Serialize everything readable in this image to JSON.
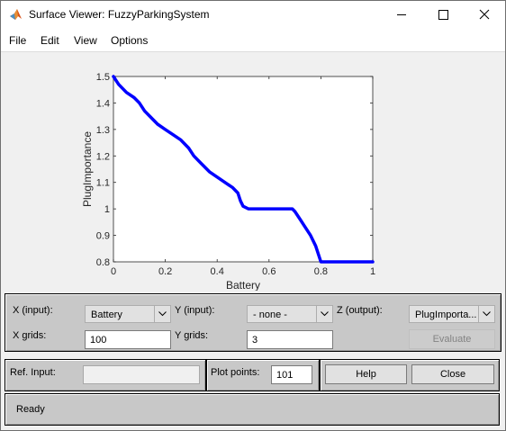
{
  "window": {
    "title": "Surface Viewer: FuzzyParkingSystem"
  },
  "menu": {
    "items": [
      "File",
      "Edit",
      "View",
      "Options"
    ]
  },
  "chart_data": {
    "type": "line",
    "xlabel": "Battery",
    "ylabel": "PlugImportance",
    "xlim": [
      0,
      1
    ],
    "ylim": [
      0.8,
      1.5
    ],
    "xticks": [
      "0",
      "0.2",
      "0.4",
      "0.6",
      "0.8",
      "1"
    ],
    "yticks": [
      "0.8",
      "0.9",
      "1",
      "1.1",
      "1.2",
      "1.3",
      "1.4",
      "1.5"
    ],
    "grid": false,
    "series": [
      {
        "color": "#0000ff",
        "x": [
          0,
          0.02,
          0.05,
          0.08,
          0.1,
          0.12,
          0.14,
          0.17,
          0.2,
          0.23,
          0.26,
          0.29,
          0.31,
          0.34,
          0.37,
          0.4,
          0.43,
          0.46,
          0.48,
          0.49,
          0.5,
          0.52,
          0.55,
          0.6,
          0.65,
          0.69,
          0.7,
          0.72,
          0.74,
          0.76,
          0.78,
          0.8,
          0.85,
          0.9,
          0.95,
          1.0
        ],
        "y": [
          1.5,
          1.47,
          1.44,
          1.42,
          1.4,
          1.37,
          1.35,
          1.32,
          1.3,
          1.28,
          1.26,
          1.23,
          1.2,
          1.17,
          1.14,
          1.12,
          1.1,
          1.08,
          1.06,
          1.03,
          1.01,
          1.0,
          1.0,
          1.0,
          1.0,
          1.0,
          0.99,
          0.96,
          0.93,
          0.9,
          0.86,
          0.8,
          0.8,
          0.8,
          0.8,
          0.8
        ]
      }
    ]
  },
  "controls": {
    "x_label": "X (input):",
    "x_value": "Battery",
    "y_label": "Y (input):",
    "y_value": "- none -",
    "z_label": "Z (output):",
    "z_value": "PlugImporta...",
    "xgrids_label": "X grids:",
    "xgrids_value": "100",
    "ygrids_label": "Y grids:",
    "ygrids_value": "3",
    "evaluate_label": "Evaluate",
    "refinput_label": "Ref. Input:",
    "refinput_value": "",
    "plotpoints_label": "Plot points:",
    "plotpoints_value": "101",
    "help_label": "Help",
    "close_label": "Close"
  },
  "status": {
    "text": "Ready"
  }
}
